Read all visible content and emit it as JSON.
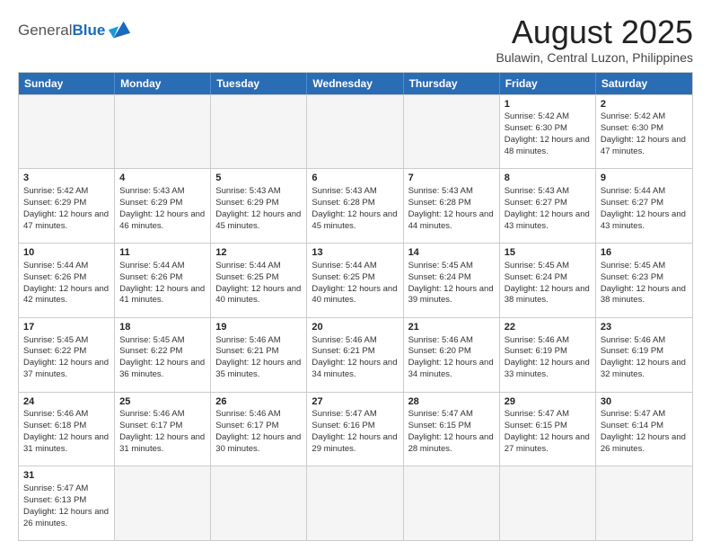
{
  "header": {
    "logo_general": "General",
    "logo_blue": "Blue",
    "title": "August 2025",
    "subtitle": "Bulawin, Central Luzon, Philippines"
  },
  "days_of_week": [
    "Sunday",
    "Monday",
    "Tuesday",
    "Wednesday",
    "Thursday",
    "Friday",
    "Saturday"
  ],
  "weeks": [
    [
      {
        "day": "",
        "info": ""
      },
      {
        "day": "",
        "info": ""
      },
      {
        "day": "",
        "info": ""
      },
      {
        "day": "",
        "info": ""
      },
      {
        "day": "",
        "info": ""
      },
      {
        "day": "1",
        "info": "Sunrise: 5:42 AM\nSunset: 6:30 PM\nDaylight: 12 hours and 48 minutes."
      },
      {
        "day": "2",
        "info": "Sunrise: 5:42 AM\nSunset: 6:30 PM\nDaylight: 12 hours and 47 minutes."
      }
    ],
    [
      {
        "day": "3",
        "info": "Sunrise: 5:42 AM\nSunset: 6:29 PM\nDaylight: 12 hours and 47 minutes."
      },
      {
        "day": "4",
        "info": "Sunrise: 5:43 AM\nSunset: 6:29 PM\nDaylight: 12 hours and 46 minutes."
      },
      {
        "day": "5",
        "info": "Sunrise: 5:43 AM\nSunset: 6:29 PM\nDaylight: 12 hours and 45 minutes."
      },
      {
        "day": "6",
        "info": "Sunrise: 5:43 AM\nSunset: 6:28 PM\nDaylight: 12 hours and 45 minutes."
      },
      {
        "day": "7",
        "info": "Sunrise: 5:43 AM\nSunset: 6:28 PM\nDaylight: 12 hours and 44 minutes."
      },
      {
        "day": "8",
        "info": "Sunrise: 5:43 AM\nSunset: 6:27 PM\nDaylight: 12 hours and 43 minutes."
      },
      {
        "day": "9",
        "info": "Sunrise: 5:44 AM\nSunset: 6:27 PM\nDaylight: 12 hours and 43 minutes."
      }
    ],
    [
      {
        "day": "10",
        "info": "Sunrise: 5:44 AM\nSunset: 6:26 PM\nDaylight: 12 hours and 42 minutes."
      },
      {
        "day": "11",
        "info": "Sunrise: 5:44 AM\nSunset: 6:26 PM\nDaylight: 12 hours and 41 minutes."
      },
      {
        "day": "12",
        "info": "Sunrise: 5:44 AM\nSunset: 6:25 PM\nDaylight: 12 hours and 40 minutes."
      },
      {
        "day": "13",
        "info": "Sunrise: 5:44 AM\nSunset: 6:25 PM\nDaylight: 12 hours and 40 minutes."
      },
      {
        "day": "14",
        "info": "Sunrise: 5:45 AM\nSunset: 6:24 PM\nDaylight: 12 hours and 39 minutes."
      },
      {
        "day": "15",
        "info": "Sunrise: 5:45 AM\nSunset: 6:24 PM\nDaylight: 12 hours and 38 minutes."
      },
      {
        "day": "16",
        "info": "Sunrise: 5:45 AM\nSunset: 6:23 PM\nDaylight: 12 hours and 38 minutes."
      }
    ],
    [
      {
        "day": "17",
        "info": "Sunrise: 5:45 AM\nSunset: 6:22 PM\nDaylight: 12 hours and 37 minutes."
      },
      {
        "day": "18",
        "info": "Sunrise: 5:45 AM\nSunset: 6:22 PM\nDaylight: 12 hours and 36 minutes."
      },
      {
        "day": "19",
        "info": "Sunrise: 5:46 AM\nSunset: 6:21 PM\nDaylight: 12 hours and 35 minutes."
      },
      {
        "day": "20",
        "info": "Sunrise: 5:46 AM\nSunset: 6:21 PM\nDaylight: 12 hours and 34 minutes."
      },
      {
        "day": "21",
        "info": "Sunrise: 5:46 AM\nSunset: 6:20 PM\nDaylight: 12 hours and 34 minutes."
      },
      {
        "day": "22",
        "info": "Sunrise: 5:46 AM\nSunset: 6:19 PM\nDaylight: 12 hours and 33 minutes."
      },
      {
        "day": "23",
        "info": "Sunrise: 5:46 AM\nSunset: 6:19 PM\nDaylight: 12 hours and 32 minutes."
      }
    ],
    [
      {
        "day": "24",
        "info": "Sunrise: 5:46 AM\nSunset: 6:18 PM\nDaylight: 12 hours and 31 minutes."
      },
      {
        "day": "25",
        "info": "Sunrise: 5:46 AM\nSunset: 6:17 PM\nDaylight: 12 hours and 31 minutes."
      },
      {
        "day": "26",
        "info": "Sunrise: 5:46 AM\nSunset: 6:17 PM\nDaylight: 12 hours and 30 minutes."
      },
      {
        "day": "27",
        "info": "Sunrise: 5:47 AM\nSunset: 6:16 PM\nDaylight: 12 hours and 29 minutes."
      },
      {
        "day": "28",
        "info": "Sunrise: 5:47 AM\nSunset: 6:15 PM\nDaylight: 12 hours and 28 minutes."
      },
      {
        "day": "29",
        "info": "Sunrise: 5:47 AM\nSunset: 6:15 PM\nDaylight: 12 hours and 27 minutes."
      },
      {
        "day": "30",
        "info": "Sunrise: 5:47 AM\nSunset: 6:14 PM\nDaylight: 12 hours and 26 minutes."
      }
    ],
    [
      {
        "day": "31",
        "info": "Sunrise: 5:47 AM\nSunset: 6:13 PM\nDaylight: 12 hours and 26 minutes."
      },
      {
        "day": "",
        "info": ""
      },
      {
        "day": "",
        "info": ""
      },
      {
        "day": "",
        "info": ""
      },
      {
        "day": "",
        "info": ""
      },
      {
        "day": "",
        "info": ""
      },
      {
        "day": "",
        "info": ""
      }
    ]
  ]
}
